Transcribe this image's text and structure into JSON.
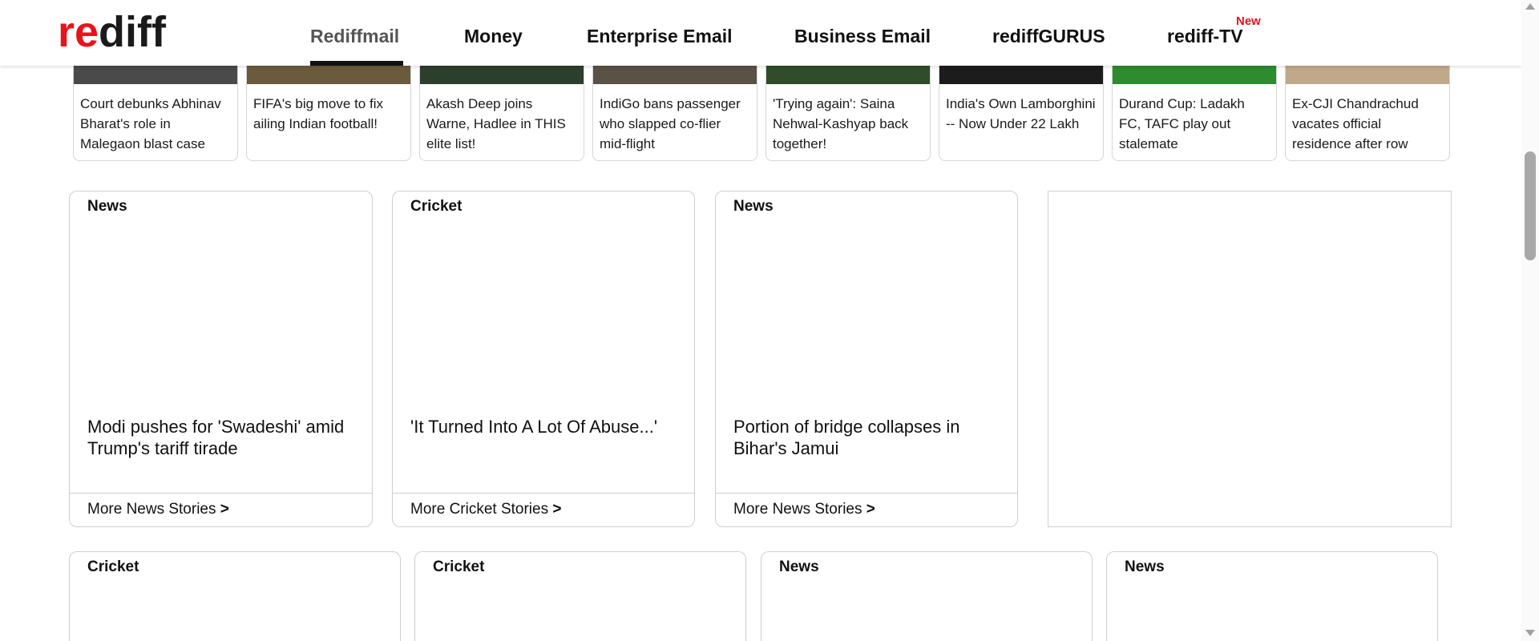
{
  "header": {
    "logo_text_r": "re",
    "logo_text_rest": "diff",
    "nav": [
      {
        "label": "Rediffmail",
        "active": true
      },
      {
        "label": "Money"
      },
      {
        "label": "Enterprise Email"
      },
      {
        "label": "Business Email"
      },
      {
        "label": "rediffGURUS"
      },
      {
        "label": "rediff-TV"
      }
    ],
    "new_badge": "New"
  },
  "thumbs": [
    {
      "text": "Court debunks Abhinav Bharat's role in Malegaon blast case",
      "color": "#4a4a4a"
    },
    {
      "text": "FIFA's big move to fix ailing Indian football!",
      "color": "#6b5a3c"
    },
    {
      "text": "Akash Deep joins Warne, Hadlee in THIS elite list!",
      "color": "#2c3e2c"
    },
    {
      "text": "IndiGo bans passenger who slapped co-flier mid-flight",
      "color": "#5a5147"
    },
    {
      "text": "'Trying again': Saina Nehwal-Kashyap back together!",
      "color": "#2f4d2a"
    },
    {
      "text": "India's Own Lamborghini -- Now Under 22 Lakh",
      "color": "#1c1c1c"
    },
    {
      "text": "Durand Cup: Ladakh FC, TAFC play out stalemate",
      "color": "#2e8b2e"
    },
    {
      "text": "Ex-CJI Chandrachud vacates official residence after row",
      "color": "#bfa98a"
    }
  ],
  "cards_row1": [
    {
      "category": "News",
      "headline": "Modi pushes for 'Swadeshi' amid Trump's tariff tirade",
      "more": "More News Stories"
    },
    {
      "category": "Cricket",
      "headline": "'It Turned Into A Lot Of Abuse...'",
      "more": "More Cricket Stories"
    },
    {
      "category": "News",
      "headline": "Portion of bridge collapses in Bihar's Jamui",
      "more": "More News Stories"
    }
  ],
  "more_arrow": ">",
  "cards_row2": [
    {
      "category": "Cricket"
    },
    {
      "category": "Cricket"
    },
    {
      "category": "News"
    },
    {
      "category": "News"
    }
  ]
}
